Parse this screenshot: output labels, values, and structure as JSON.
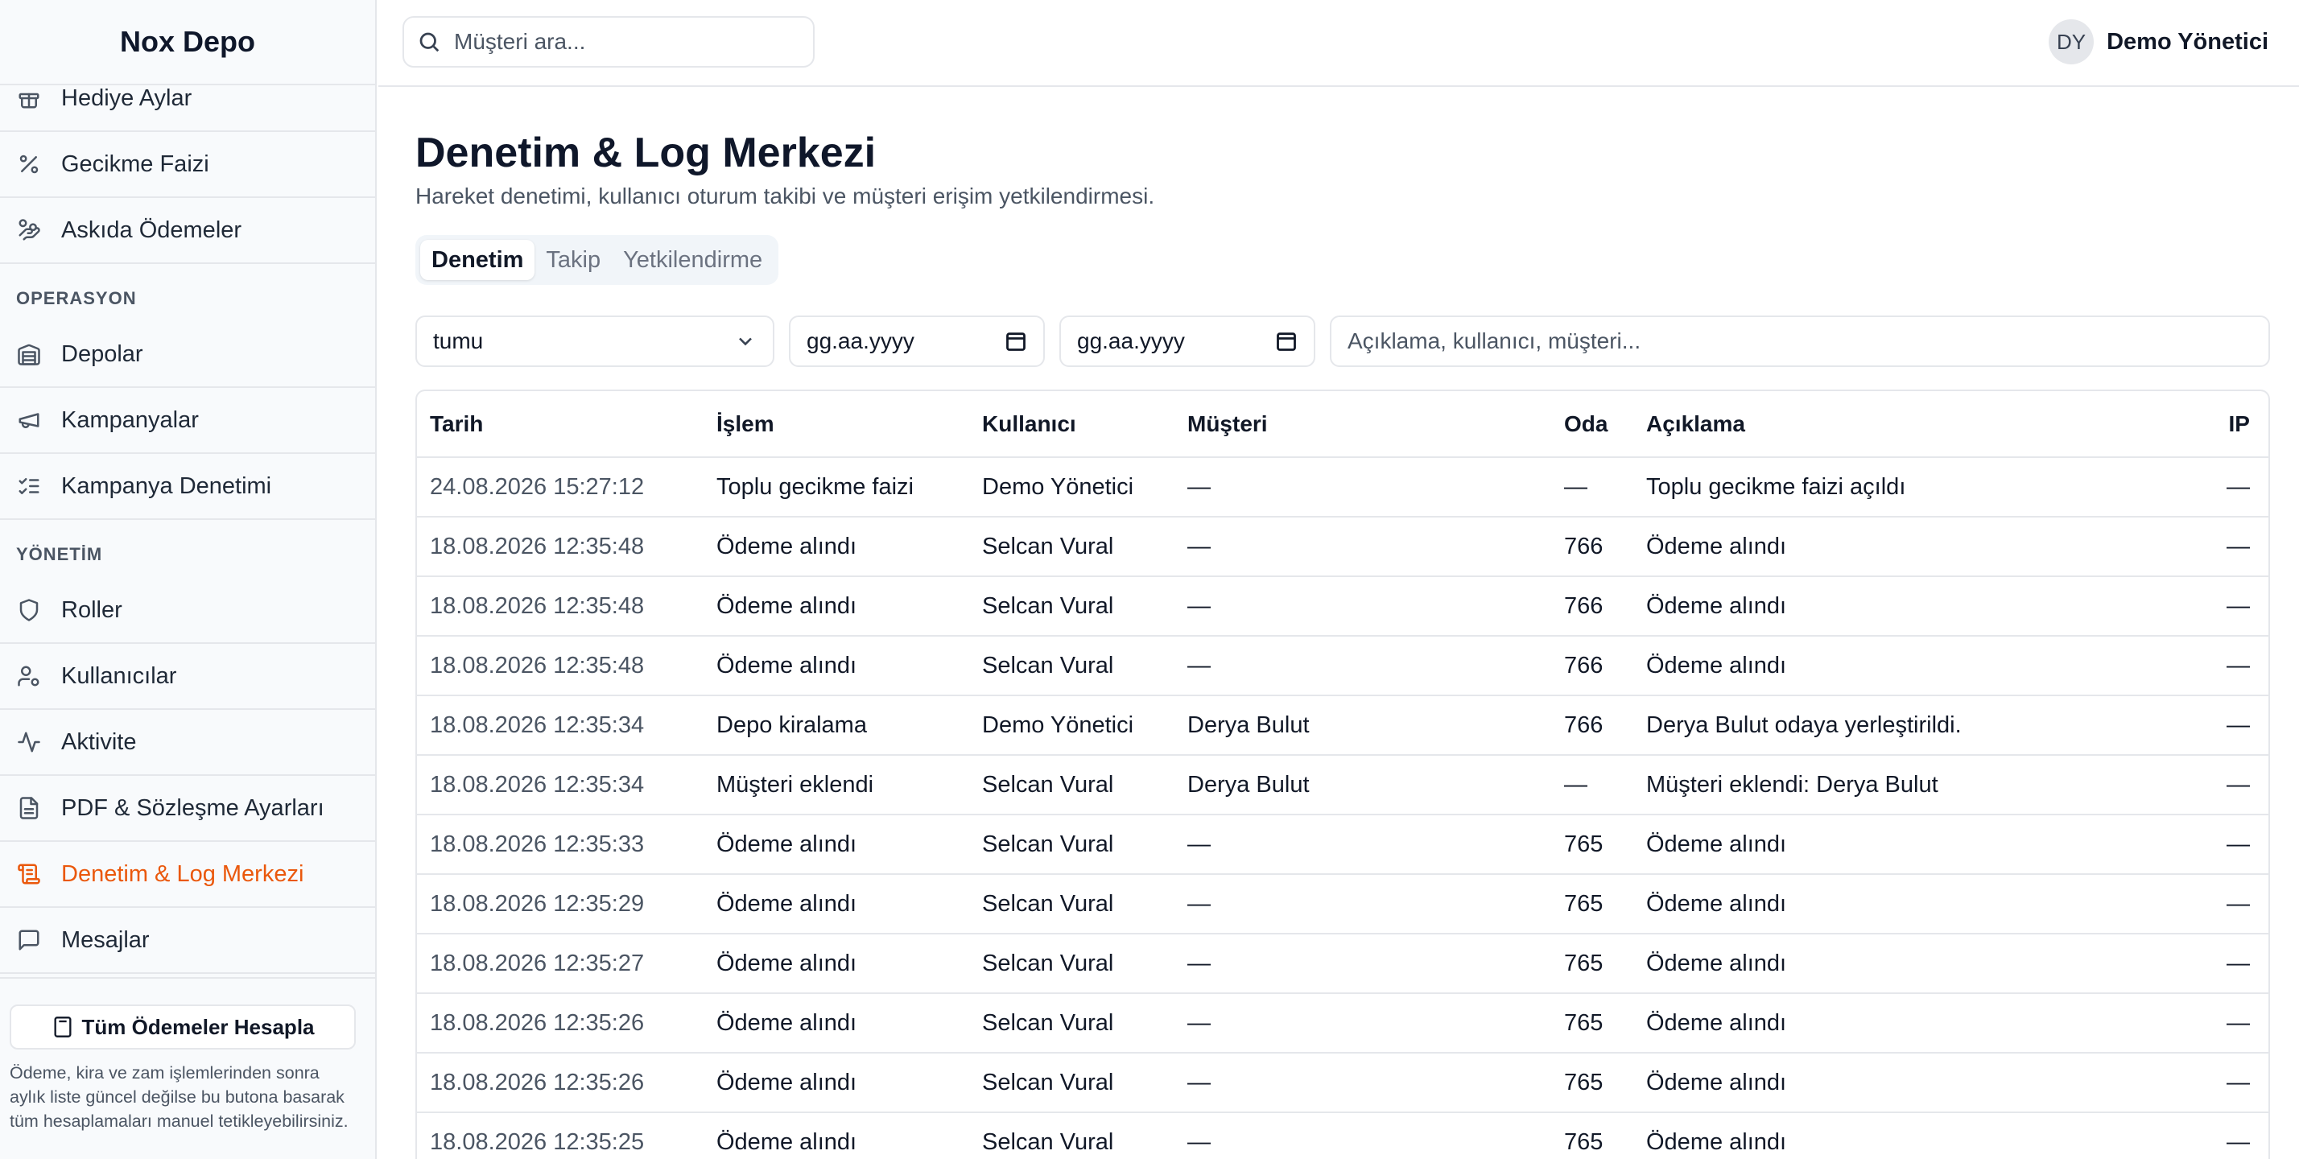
{
  "app": {
    "brand": "Nox Depo"
  },
  "sidebar": {
    "items_top": [
      {
        "label": "Hediye Aylar",
        "icon": "gift-icon"
      },
      {
        "label": "Gecikme Faizi",
        "icon": "percent-icon"
      },
      {
        "label": "Askıda Ödemeler",
        "icon": "hand-coins-icon"
      }
    ],
    "section_operasyon": "OPERASYON",
    "items_operasyon": [
      {
        "label": "Depolar",
        "icon": "warehouse-icon"
      },
      {
        "label": "Kampanyalar",
        "icon": "megaphone-icon"
      },
      {
        "label": "Kampanya Denetimi",
        "icon": "list-checks-icon"
      }
    ],
    "section_yonetim": "YÖNETİM",
    "items_yonetim": [
      {
        "label": "Roller",
        "icon": "shield-icon"
      },
      {
        "label": "Kullanıcılar",
        "icon": "user-cog-icon"
      },
      {
        "label": "Aktivite",
        "icon": "activity-icon"
      },
      {
        "label": "PDF & Sözleşme Ayarları",
        "icon": "file-text-icon"
      },
      {
        "label": "Denetim & Log Merkezi",
        "icon": "scroll-icon",
        "active": true
      },
      {
        "label": "Mesajlar",
        "icon": "message-square-icon"
      }
    ],
    "calc_button": "Tüm Ödemeler Hesapla",
    "footer_note": "Ödeme, kira ve zam işlemlerinden sonra aylık liste güncel değilse bu butona basarak tüm hesaplamaları manuel tetikleyebilirsiniz."
  },
  "header": {
    "search_placeholder": "Müşteri ara...",
    "user_initials": "DY",
    "user_name": "Demo Yönetici"
  },
  "page": {
    "title": "Denetim & Log Merkezi",
    "subtitle": "Hareket denetimi, kullanıcı oturum takibi ve müşteri erişim yetkilendirmesi.",
    "tabs": [
      {
        "label": "Denetim",
        "active": true
      },
      {
        "label": "Takip"
      },
      {
        "label": "Yetkilendirme"
      }
    ],
    "filters": {
      "type_value": "tumu",
      "date_from": "gg.aa.yyyy",
      "date_to": "gg.aa.yyyy",
      "text_placeholder": "Açıklama, kullanıcı, müşteri..."
    }
  },
  "table": {
    "headers": [
      "Tarih",
      "İşlem",
      "Kullanıcı",
      "Müşteri",
      "Oda",
      "Açıklama",
      "IP"
    ],
    "rows": [
      [
        "24.08.2026 15:27:12",
        "Toplu gecikme faizi",
        "Demo Yönetici",
        "—",
        "—",
        "Toplu gecikme faizi açıldı",
        "—"
      ],
      [
        "18.08.2026 12:35:48",
        "Ödeme alındı",
        "Selcan Vural",
        "—",
        "766",
        "Ödeme alındı",
        "—"
      ],
      [
        "18.08.2026 12:35:48",
        "Ödeme alındı",
        "Selcan Vural",
        "—",
        "766",
        "Ödeme alındı",
        "—"
      ],
      [
        "18.08.2026 12:35:48",
        "Ödeme alındı",
        "Selcan Vural",
        "—",
        "766",
        "Ödeme alındı",
        "—"
      ],
      [
        "18.08.2026 12:35:34",
        "Depo kiralama",
        "Demo Yönetici",
        "Derya Bulut",
        "766",
        "Derya Bulut odaya yerleştirildi.",
        "—"
      ],
      [
        "18.08.2026 12:35:34",
        "Müşteri eklendi",
        "Selcan Vural",
        "Derya Bulut",
        "—",
        "Müşteri eklendi: Derya Bulut",
        "—"
      ],
      [
        "18.08.2026 12:35:33",
        "Ödeme alındı",
        "Selcan Vural",
        "—",
        "765",
        "Ödeme alındı",
        "—"
      ],
      [
        "18.08.2026 12:35:29",
        "Ödeme alındı",
        "Selcan Vural",
        "—",
        "765",
        "Ödeme alındı",
        "—"
      ],
      [
        "18.08.2026 12:35:27",
        "Ödeme alındı",
        "Selcan Vural",
        "—",
        "765",
        "Ödeme alındı",
        "—"
      ],
      [
        "18.08.2026 12:35:26",
        "Ödeme alındı",
        "Selcan Vural",
        "—",
        "765",
        "Ödeme alındı",
        "—"
      ],
      [
        "18.08.2026 12:35:26",
        "Ödeme alındı",
        "Selcan Vural",
        "—",
        "765",
        "Ödeme alındı",
        "—"
      ],
      [
        "18.08.2026 12:35:25",
        "Ödeme alındı",
        "Selcan Vural",
        "—",
        "765",
        "Ödeme alındı",
        "—"
      ]
    ]
  },
  "colors": {
    "accent": "#ea580c",
    "border": "#e5e7eb",
    "sidebar_bg": "#f8fafc"
  }
}
